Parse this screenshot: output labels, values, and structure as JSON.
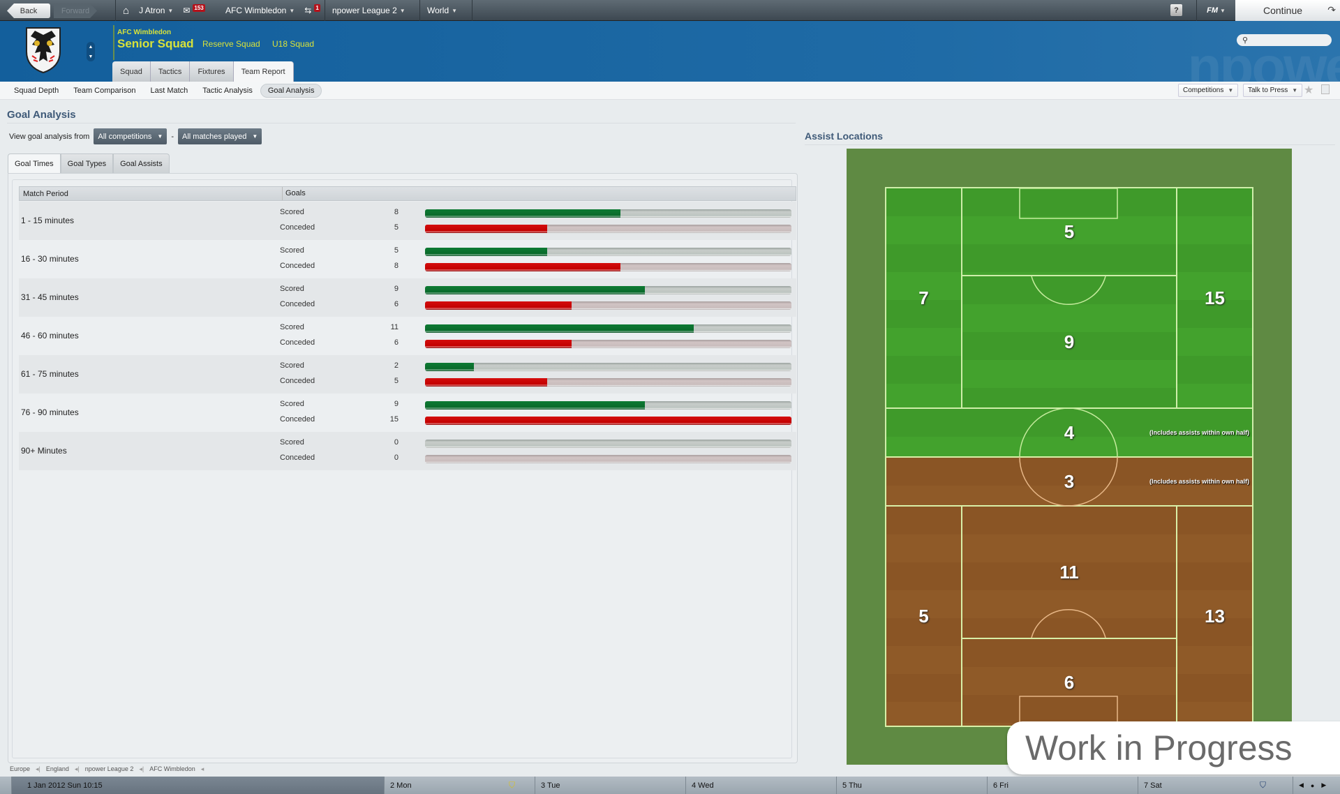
{
  "topbar": {
    "back_label": "Back",
    "forward_label": "Forward",
    "home_icon": "home-icon",
    "manager": "J Atron",
    "inbox_count": "153",
    "club": "AFC Wimbledon",
    "transfer_count": "1",
    "league": "npower League 2",
    "world": "World",
    "help_label": "?",
    "fm_label": "FM",
    "continue_label": "Continue"
  },
  "header": {
    "club_name": "AFC Wimbledon",
    "squad_title": "Senior Squad",
    "reserve_link": "Reserve Squad",
    "u18_link": "U18 Squad",
    "watermark": "npowe",
    "search_placeholder": "",
    "tabs": [
      {
        "label": "Squad",
        "active": false
      },
      {
        "label": "Tactics",
        "active": false
      },
      {
        "label": "Fixtures",
        "active": false
      },
      {
        "label": "Team Report",
        "active": true
      }
    ]
  },
  "subnav": {
    "items": [
      {
        "label": "Squad Depth",
        "active": false
      },
      {
        "label": "Team Comparison",
        "active": false
      },
      {
        "label": "Last Match",
        "active": false
      },
      {
        "label": "Tactic Analysis",
        "active": false
      },
      {
        "label": "Goal Analysis",
        "active": true
      }
    ],
    "competitions_label": "Competitions",
    "talk_to_press_label": "Talk to Press"
  },
  "page": {
    "title": "Goal Analysis",
    "filter_label": "View goal analysis from",
    "filter_competition": "All competitions",
    "filter_separator": "-",
    "filter_matches": "All matches played",
    "tabs": [
      {
        "label": "Goal Times",
        "active": true
      },
      {
        "label": "Goal Types",
        "active": false
      },
      {
        "label": "Goal Assists",
        "active": false
      }
    ]
  },
  "chart_data": {
    "type": "bar",
    "title": "Goal Times",
    "columns": [
      "Match Period",
      "Goals"
    ],
    "series_labels": {
      "scored": "Scored",
      "conceded": "Conceded"
    },
    "bar_max": 15,
    "colors": {
      "scored": "#0a6a2b",
      "conceded": "#c20000"
    },
    "categories": [
      "1 - 15 minutes",
      "16 - 30 minutes",
      "31 - 45 minutes",
      "46 - 60 minutes",
      "61 - 75 minutes",
      "76 - 90 minutes",
      "90+ Minutes"
    ],
    "series": [
      {
        "name": "Scored",
        "values": [
          8,
          5,
          9,
          11,
          2,
          9,
          0
        ]
      },
      {
        "name": "Conceded",
        "values": [
          5,
          8,
          6,
          6,
          5,
          15,
          0
        ]
      }
    ]
  },
  "assist_locations": {
    "title": "Assist Locations",
    "note": "(Includes assists within own half)",
    "attacking_half": {
      "left_wing": "7",
      "box": "5",
      "centre": "9",
      "right_wing": "15",
      "midfield": "4"
    },
    "defending_half": {
      "midfield": "3",
      "left_wing": "5",
      "centre": "11",
      "box": "6",
      "right_wing": "13"
    }
  },
  "overlay": {
    "text": "Work in Progress"
  },
  "breadcrumb": [
    "Europe",
    "England",
    "npower League 2",
    "AFC Wimbledon"
  ],
  "calendar": {
    "today": "1 Jan 2012  Sun  10:15",
    "days": [
      "2 Mon",
      "3 Tue",
      "4 Wed",
      "5 Thu",
      "6 Fri",
      "7 Sat"
    ]
  }
}
